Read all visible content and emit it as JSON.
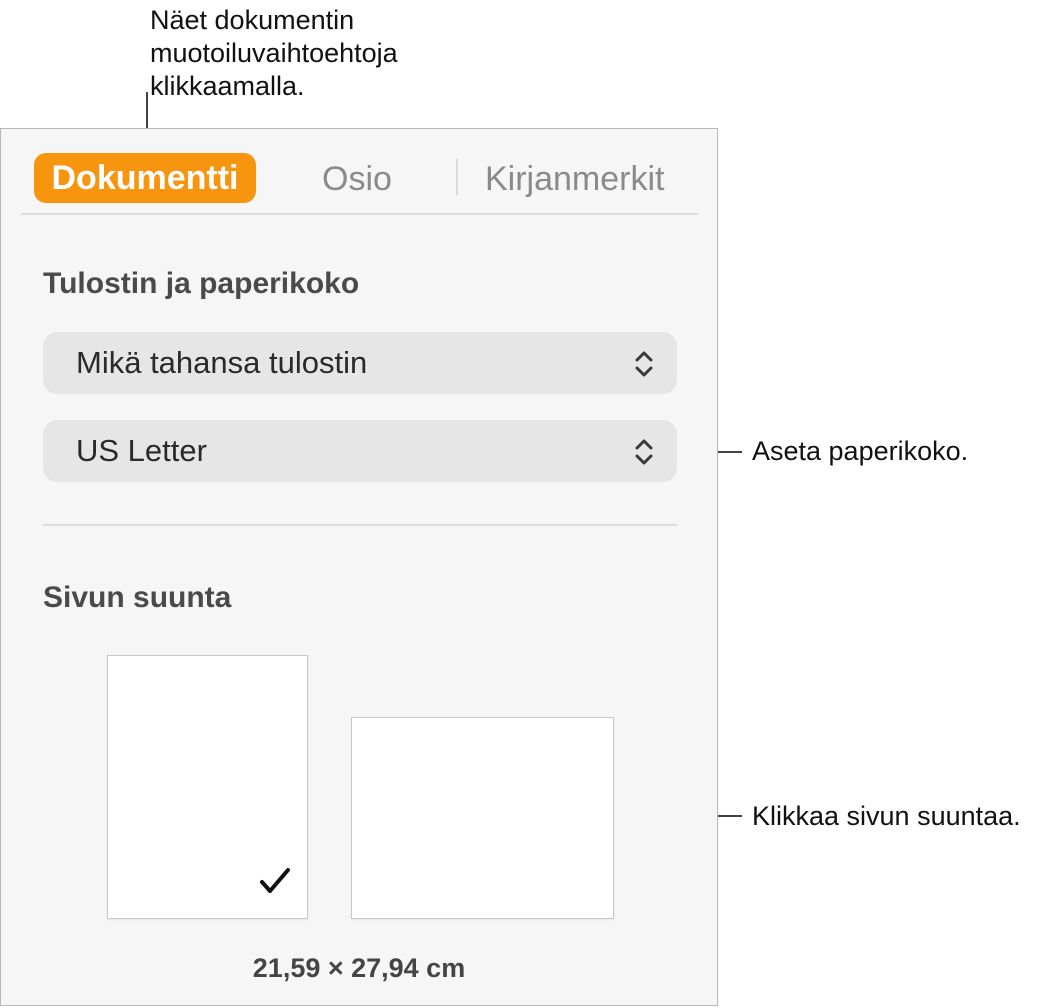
{
  "callouts": {
    "tabs": [
      "Näet dokumentin",
      "muotoiluvaihtoehtoja",
      "klikkaamalla."
    ],
    "paper_size": "Aseta paperikoko.",
    "orientation": "Klikkaa sivun suuntaa."
  },
  "tabs": [
    {
      "label": "Dokumentti",
      "selected": true
    },
    {
      "label": "Osio",
      "selected": false
    },
    {
      "label": "Kirjanmerkit",
      "selected": false
    }
  ],
  "colors": {
    "accent": "#f7950e"
  },
  "printer_section": {
    "heading": "Tulostin ja paperikoko",
    "printer_value": "Mikä tahansa tulostin",
    "paper_value": "US Letter"
  },
  "orientation_section": {
    "heading": "Sivun suunta",
    "options": [
      {
        "name": "portrait",
        "selected": true
      },
      {
        "name": "landscape",
        "selected": false
      }
    ],
    "dimensions": "21,59 × 27,94 cm"
  },
  "icons": {
    "popup_indicator": "chevron-up-down-icon",
    "selected_mark": "checkmark-icon"
  }
}
